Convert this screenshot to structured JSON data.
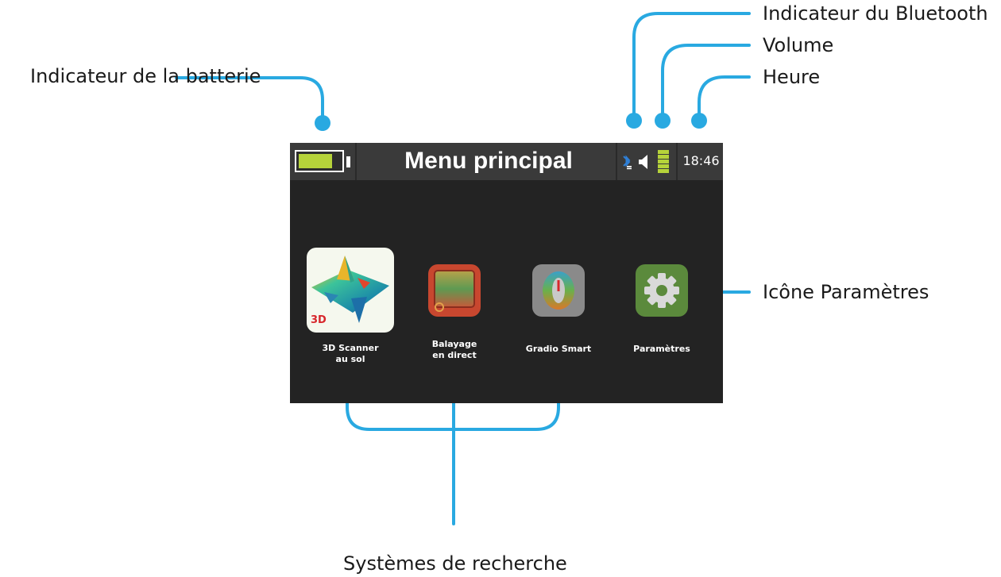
{
  "callouts": {
    "battery": "Indicateur de la batterie",
    "bluetooth": "Indicateur du Bluetooth",
    "volume": "Volume",
    "time": "Heure",
    "settings_icon": "Icône Paramètres",
    "search_systems": "Systèmes de recherche"
  },
  "screen": {
    "title": "Menu principal",
    "clock": "18:46",
    "battery_level": 0.8,
    "apps": [
      {
        "label_line1": "3D Scanner",
        "label_line2": "au sol",
        "badge": "3D"
      },
      {
        "label_line1": "Balayage",
        "label_line2": "en direct"
      },
      {
        "label": "Gradio Smart"
      },
      {
        "label": "Paramètres"
      }
    ]
  },
  "colors": {
    "callout_line": "#29a9e1",
    "screen_bg": "#232323",
    "status_bar": "#3a3a3a",
    "battery_fill": "#b6d33a",
    "settings_tile": "#5b8a3c",
    "scanner_tile": "#f5f8ee",
    "live_scan_tile": "#c8472f",
    "gradio_tile": "#8a8a8a",
    "bluetooth": "#2f7fd6"
  }
}
